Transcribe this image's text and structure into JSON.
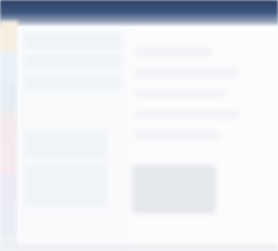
{
  "window": {
    "title": ""
  },
  "colors": {
    "titlebar_dark": "#2e4066",
    "titlebar_mid": "#3f5680",
    "background": "#f8f9fb"
  },
  "sidebar": {
    "items": [
      {
        "icon": "app-icon"
      },
      {
        "icon": "nav-icon"
      },
      {
        "icon": "nav-icon"
      },
      {
        "icon": "nav-icon"
      },
      {
        "icon": "nav-icon"
      },
      {
        "icon": "nav-icon"
      },
      {
        "icon": "nav-icon"
      }
    ]
  },
  "content": {
    "note": ""
  }
}
